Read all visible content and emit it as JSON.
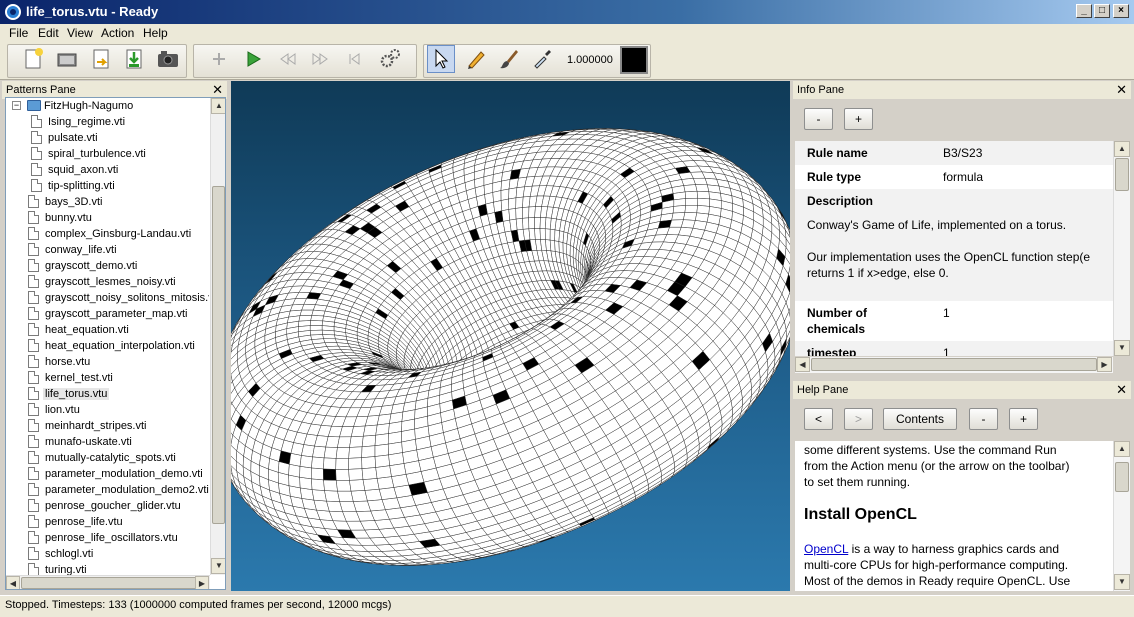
{
  "window": {
    "title": "life_torus.vtu - Ready",
    "controls": [
      "_",
      "□",
      "×"
    ]
  },
  "menu": [
    "File",
    "Edit",
    "View",
    "Action",
    "Help"
  ],
  "toolbar": {
    "zoom_value": "1.000000",
    "buttons": [
      "new-icon",
      "open-icon",
      "reload-icon",
      "save-icon",
      "screenshot-icon",
      "add-icon",
      "run-icon",
      "rewind-icon",
      "fast-forward-icon",
      "step-icon",
      "settings-icon",
      "pointer-icon",
      "pencil-icon",
      "brush-icon",
      "eyedropper-icon"
    ],
    "color": "#000000"
  },
  "patterns_pane": {
    "title": "Patterns Pane",
    "close": "✕",
    "folder": "FitzHugh-Nagumo",
    "folder_children": [
      "Ising_regime.vti",
      "pulsate.vti",
      "spiral_turbulence.vti",
      "squid_axon.vti",
      "tip-splitting.vti"
    ],
    "items": [
      "bays_3D.vti",
      "bunny.vtu",
      "complex_Ginsburg-Landau.vti",
      "conway_life.vti",
      "grayscott_demo.vti",
      "grayscott_lesmes_noisy.vti",
      "grayscott_noisy_solitons_mitosis.vti",
      "grayscott_parameter_map.vti",
      "heat_equation.vti",
      "heat_equation_interpolation.vti",
      "horse.vtu",
      "kernel_test.vti",
      "life_torus.vtu",
      "lion.vtu",
      "meinhardt_stripes.vti",
      "munafo-uskate.vti",
      "mutually-catalytic_spots.vti",
      "parameter_modulation_demo.vti",
      "parameter_modulation_demo2.vti",
      "penrose_goucher_glider.vtu",
      "penrose_life.vtu",
      "penrose_life_oscillators.vtu",
      "schlogl.vti",
      "turing.vti"
    ],
    "selected": "life_torus.vtu"
  },
  "info_pane": {
    "title": "Info Pane",
    "close": "✕",
    "minus": "-",
    "plus": "+",
    "rule_name_label": "Rule name",
    "rule_name": "B3/S23",
    "rule_type_label": "Rule type",
    "rule_type": "formula",
    "description_label": "Description",
    "desc_line1": "Conway's Game of Life, implemented on a torus.",
    "desc_line2": "Our implementation uses the OpenCL function step(e",
    "desc_line3": "returns 1 if x>edge, else 0.",
    "chemicals_label_1": "Number of",
    "chemicals_label_2": "chemicals",
    "chemicals_value": "1",
    "timestep_label": "timestep",
    "timestep_value": "1"
  },
  "help_pane": {
    "title": "Help Pane",
    "close": "✕",
    "back": "<",
    "forward": ">",
    "contents": "Contents",
    "minus": "-",
    "plus": "+",
    "para1_line1": "some different systems. Use the command Run",
    "para1_line2": "from the Action menu (or the arrow on the toolbar)",
    "para1_line3": "to set them running.",
    "heading": "Install OpenCL",
    "link": "OpenCL",
    "para2_line1_rest": " is a way to harness graphics cards and",
    "para2_line2": "multi-core CPUs for high-performance computing.",
    "para2_line3": "Most of the demos in Ready require OpenCL. Use"
  },
  "status": "Stopped. Timesteps: 133   (1000000 computed frames per second, 12000 mcgs)"
}
